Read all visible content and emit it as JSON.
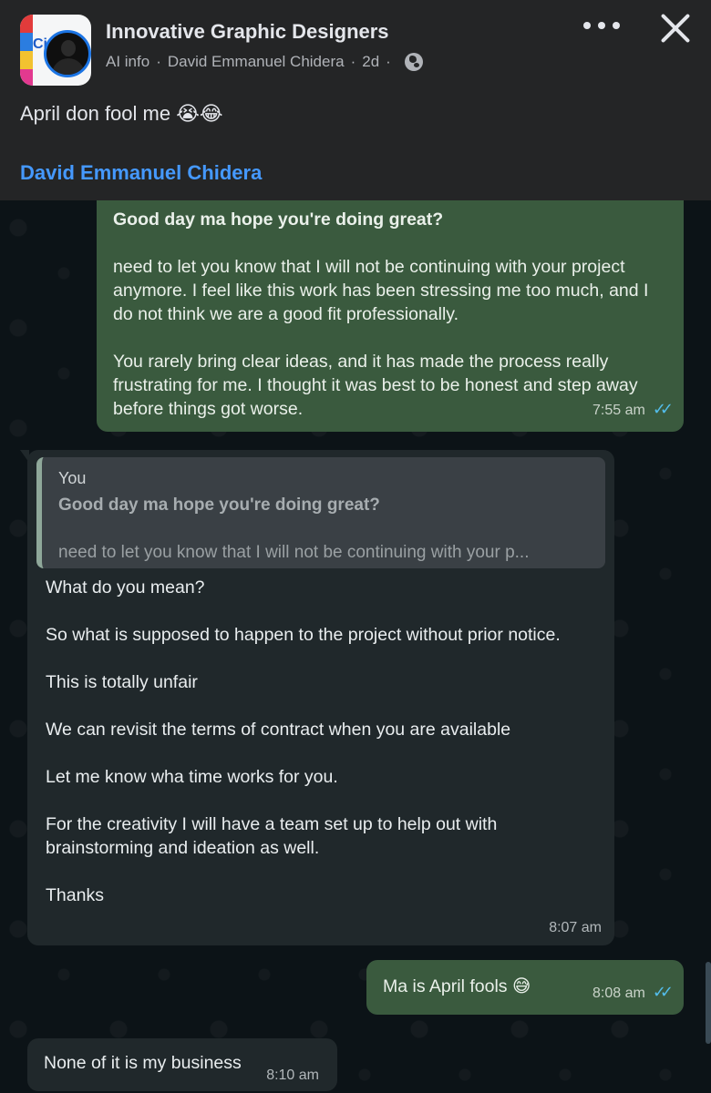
{
  "post": {
    "group_name": "Innovative Graphic Designers",
    "meta_ai_info": "AI info",
    "meta_author": "David Emmanuel Chidera",
    "meta_time": "2d",
    "caption": "April don fool me",
    "caption_emojis": "😭😂",
    "author_link": "David Emmanuel Chidera",
    "icons": [
      "globe-icon",
      "more-icon",
      "close-icon"
    ],
    "group_avatar_text": "Ci"
  },
  "chat": {
    "messages": [
      {
        "direction": "outgoing",
        "title": "Good day ma hope you're doing great?",
        "paragraphs": [
          "need to let you know that I will not be continuing with your project anymore. I feel like this work has been stressing me too much, and I do not think we are a good fit professionally.",
          "You rarely bring clear ideas, and it has made the process really frustrating for me. I thought it was best to be honest and step away before things got worse."
        ],
        "time": "7:55 am",
        "status": "read"
      },
      {
        "direction": "incoming",
        "quote": {
          "sender": "You",
          "line1": "Good day ma hope you're doing great?",
          "line2": "need to let you know that I will not be continuing with your p..."
        },
        "paragraphs": [
          "What do you mean?",
          "So what is supposed to happen to the project without prior notice.",
          "This is totally unfair",
          "We can revisit the terms of contract when you are available",
          "Let me know wha time works for you.",
          "For the creativity I will have a team set up to help out with brainstorming and ideation as well.",
          "Thanks"
        ],
        "time": "8:07 am"
      },
      {
        "direction": "outgoing",
        "text": "Ma is April fools",
        "emoji": "😅",
        "time": "8:08 am",
        "status": "read"
      },
      {
        "direction": "incoming",
        "text": "None of it is my business",
        "time": "8:10 am"
      }
    ],
    "ticks_glyph": "✓✓"
  },
  "colors": {
    "facebook_bg": "#242526",
    "link_blue": "#4599ff",
    "chat_bg": "#0c1317",
    "outgoing_bubble": "#3a5a3e",
    "incoming_bubble": "#20282b",
    "read_ticks": "#53bdeb"
  }
}
